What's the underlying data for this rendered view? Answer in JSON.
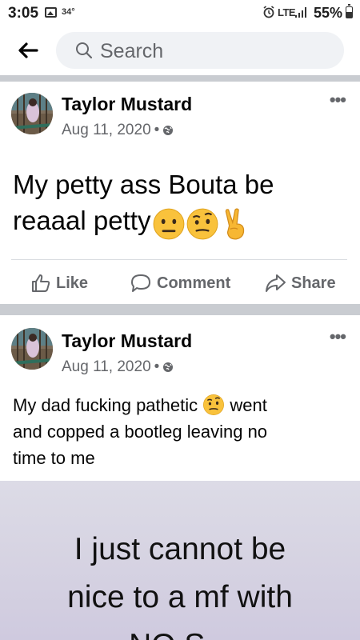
{
  "status_bar": {
    "time": "3:05",
    "temperature": "34°",
    "network": "LTE",
    "battery": "55%"
  },
  "header": {
    "search_placeholder": "Search"
  },
  "posts": [
    {
      "author": "Taylor Mustard",
      "date": "Aug 11, 2020",
      "text_line1": "My petty ass Bouta be",
      "text_line2": "reaaal petty",
      "emojis": [
        "neutral-face",
        "face-with-raised-eyebrow",
        "victory-hand"
      ],
      "actions": {
        "like": "Like",
        "comment": "Comment",
        "share": "Share"
      }
    },
    {
      "author": "Taylor Mustard",
      "date": "Aug 11, 2020",
      "text_line1_a": "My dad fucking pathetic",
      "text_line1_b": "went",
      "text_line2": "and copped a bootleg leaving no",
      "text_line3": "time to me",
      "emojis": [
        "face-with-raised-eyebrow"
      ],
      "image_text": [
        "I just cannot be",
        "nice to a mf with",
        "NO S..."
      ]
    }
  ]
}
